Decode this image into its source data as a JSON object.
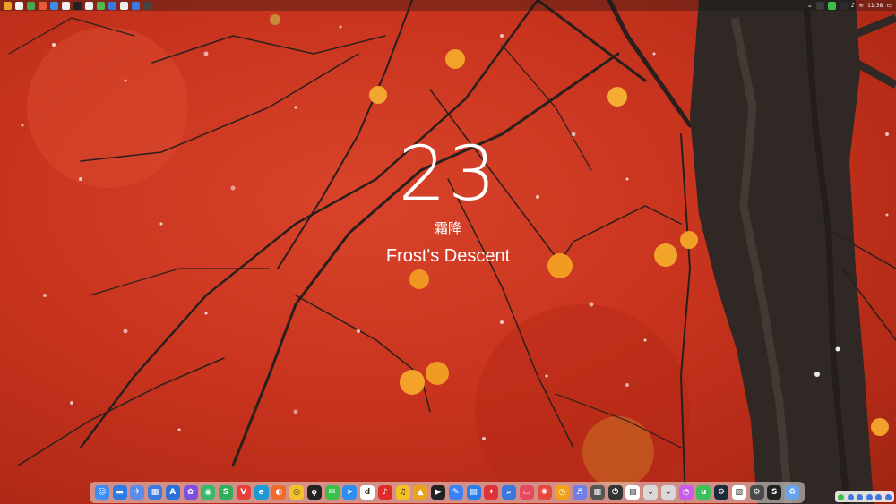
{
  "wallpaper": {
    "day": "23",
    "solar_term_cn": "霜降",
    "solar_term_en": "Frost's Descent",
    "colors": {
      "wall_red": "#c8341e",
      "persimmon": "#f2a22a",
      "trunk": "#2b2420"
    }
  },
  "topbar": {
    "clock": "11:38",
    "left_icons": [
      "finder-icon",
      "calendar-icon",
      "notes-icon",
      "photos-icon",
      "messages-icon",
      "mail-icon",
      "chrome-icon",
      "browser-icon",
      "terminal-icon",
      "app-icon",
      "app-icon",
      "app-icon",
      "app-icon",
      "app-icon"
    ],
    "right_icons": [
      "chevron-down-icon",
      "shield-icon",
      "wechat-icon",
      "qq-icon",
      "volume-icon",
      "wifi-icon",
      "battery-icon",
      "screen-icon"
    ]
  },
  "dock": {
    "items": [
      {
        "name": "finder-icon",
        "color": "#3a8ef6",
        "glyph": "☺"
      },
      {
        "name": "desktop-icon",
        "color": "#2d7be5",
        "glyph": "▬"
      },
      {
        "name": "launchpad-icon",
        "color": "#5a8de8",
        "glyph": "✈"
      },
      {
        "name": "windows-icon",
        "color": "#3d7ae0",
        "glyph": "▦"
      },
      {
        "name": "app-store-icon",
        "color": "#2f6fd8",
        "glyph": "A"
      },
      {
        "name": "game-icon",
        "color": "#7e4fe0",
        "glyph": "✿"
      },
      {
        "name": "ai-icon",
        "color": "#37b86b",
        "glyph": "◉"
      },
      {
        "name": "evernote-icon",
        "color": "#2fae5b",
        "glyph": "S"
      },
      {
        "name": "vivaldi-icon",
        "color": "#e5413b",
        "glyph": "V"
      },
      {
        "name": "edge-icon",
        "color": "#1c9ad6",
        "glyph": "e"
      },
      {
        "name": "firefox-icon",
        "color": "#f06a2a",
        "glyph": "◐"
      },
      {
        "name": "chrome-icon",
        "color": "#f2c12e",
        "glyph": "◎"
      },
      {
        "name": "qq-icon",
        "color": "#222222",
        "glyph": "ϙ"
      },
      {
        "name": "wechat-icon",
        "color": "#3cbf4a",
        "glyph": "✉"
      },
      {
        "name": "feishu-icon",
        "color": "#2c8ef0",
        "glyph": "➤"
      },
      {
        "name": "tiktok-icon",
        "color": "#ffffff",
        "glyph": "d"
      },
      {
        "name": "netease-music-icon",
        "color": "#e02b2b",
        "glyph": "♪"
      },
      {
        "name": "qq-music-icon",
        "color": "#f5c021",
        "glyph": "♫"
      },
      {
        "name": "obsidian-icon",
        "color": "#e9a31f",
        "glyph": "▲"
      },
      {
        "name": "player-icon",
        "color": "#222222",
        "glyph": "▶"
      },
      {
        "name": "docs-icon",
        "color": "#3b82f6",
        "glyph": "✎"
      },
      {
        "name": "grid-app-icon",
        "color": "#2b7de9",
        "glyph": "▤"
      },
      {
        "name": "pdf-icon",
        "color": "#e0323b",
        "glyph": "✦"
      },
      {
        "name": "search-icon",
        "color": "#3a78e0",
        "glyph": "⌕"
      },
      {
        "name": "slides-icon",
        "color": "#e44b5f",
        "glyph": "▭"
      },
      {
        "name": "mathematica-icon",
        "color": "#e7483c",
        "glyph": "✺"
      },
      {
        "name": "clock-app-icon",
        "color": "#f2a11c",
        "glyph": "◷"
      },
      {
        "name": "audio-icon",
        "color": "#6f7ee8",
        "glyph": "♬"
      },
      {
        "name": "utilities-icon",
        "color": "#555555",
        "glyph": "▦"
      },
      {
        "name": "power-icon",
        "color": "#333333",
        "glyph": "⏻"
      },
      {
        "name": "calendar-icon",
        "color": "#ffffff",
        "glyph": "▤"
      },
      {
        "name": "folder-icon",
        "color": "#d9d9d9",
        "glyph": "⌄"
      },
      {
        "name": "downloads-icon",
        "color": "#d9d9d9",
        "glyph": "⌄"
      },
      {
        "name": "gradient-app-icon",
        "color": "#c95ce8",
        "glyph": "◔"
      },
      {
        "name": "upwork-icon",
        "color": "#3dbf5b",
        "glyph": "u"
      },
      {
        "name": "steam-icon",
        "color": "#1d2a3a",
        "glyph": "⚙"
      },
      {
        "name": "photos-icon",
        "color": "#ffffff",
        "glyph": "▨"
      },
      {
        "name": "settings-icon",
        "color": "#4a4a4a",
        "glyph": "⚙"
      },
      {
        "name": "hook-icon",
        "color": "#222222",
        "glyph": "S"
      },
      {
        "name": "trash-icon",
        "color": "#6aa3e8",
        "glyph": "♻"
      }
    ]
  },
  "tray": {
    "items": [
      "wechat-icon",
      "input-icon",
      "mic-icon",
      "speaker-icon",
      "wifi-icon",
      "user-icon"
    ]
  }
}
